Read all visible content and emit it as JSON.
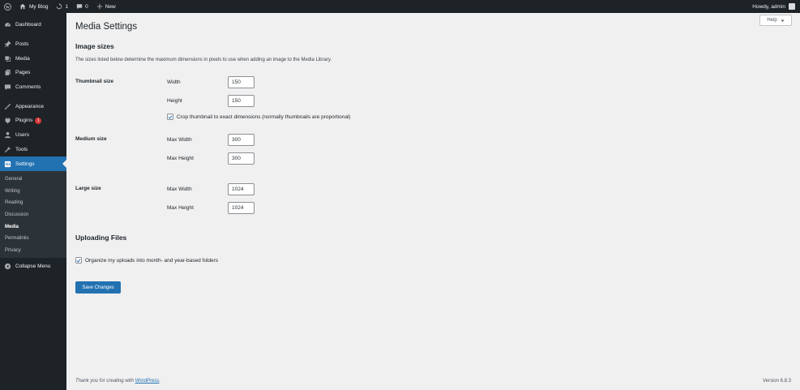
{
  "adminbar": {
    "site_name": "My Blog",
    "updates_count": "1",
    "comments_count": "0",
    "new_label": "New",
    "howdy": "Howdy, admin"
  },
  "sidebar": {
    "items": [
      {
        "label": "Dashboard",
        "icon": "dashboard-icon"
      },
      {
        "label": "Posts",
        "icon": "pin-icon"
      },
      {
        "label": "Media",
        "icon": "media-icon"
      },
      {
        "label": "Pages",
        "icon": "pages-icon"
      },
      {
        "label": "Comments",
        "icon": "comments-icon"
      },
      {
        "label": "Appearance",
        "icon": "brush-icon"
      },
      {
        "label": "Plugins",
        "icon": "plugin-icon",
        "badge": "1"
      },
      {
        "label": "Users",
        "icon": "users-icon"
      },
      {
        "label": "Tools",
        "icon": "wrench-icon"
      },
      {
        "label": "Settings",
        "icon": "settings-icon"
      }
    ],
    "submenu": [
      "General",
      "Writing",
      "Reading",
      "Discussion",
      "Media",
      "Permalinks",
      "Privacy"
    ],
    "collapse_label": "Collapse Menu"
  },
  "help_label": "Help",
  "page_title": "Media Settings",
  "image_sizes": {
    "heading": "Image sizes",
    "description": "The sizes listed below determine the maximum dimensions in pixels to use when adding an image to the Media Library.",
    "thumbnail": {
      "label": "Thumbnail size",
      "width_label": "Width",
      "width_value": "150",
      "height_label": "Height",
      "height_value": "150",
      "crop_label": "Crop thumbnail to exact dimensions (normally thumbnails are proportional)"
    },
    "medium": {
      "label": "Medium size",
      "width_label": "Max Width",
      "width_value": "300",
      "height_label": "Max Height",
      "height_value": "300"
    },
    "large": {
      "label": "Large size",
      "width_label": "Max Width",
      "width_value": "1024",
      "height_label": "Max Height",
      "height_value": "1024"
    }
  },
  "uploading": {
    "heading": "Uploading Files",
    "organize_label": "Organize my uploads into month- and year-based folders"
  },
  "save_label": "Save Changes",
  "footer": {
    "thanks_prefix": "Thank you for creating with ",
    "wordpress_link": "WordPress",
    "thanks_suffix": ".",
    "version": "Version 6.8.3"
  },
  "colors": {
    "accent": "#2271b1",
    "adminbar_bg": "#1d2327",
    "page_bg": "#f0f0f1",
    "badge": "#d63638"
  }
}
